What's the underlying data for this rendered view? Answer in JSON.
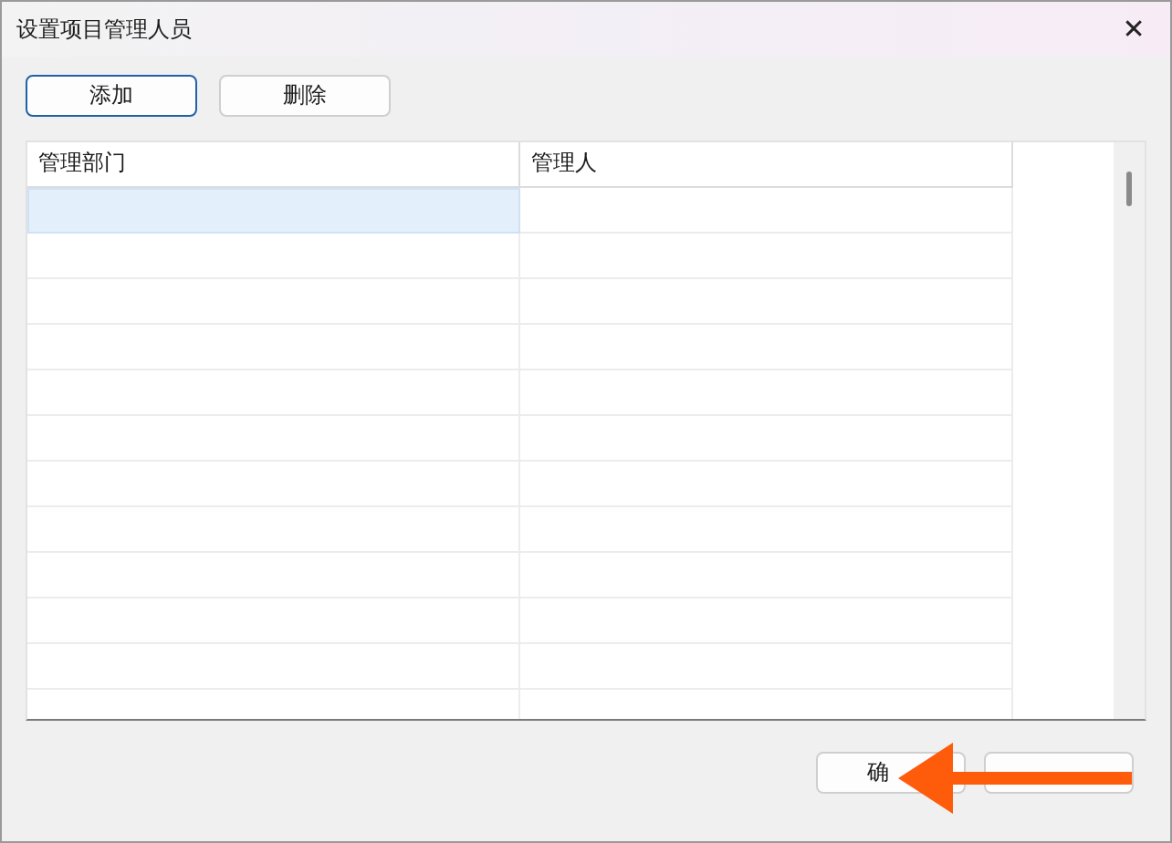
{
  "window": {
    "title": "设置项目管理人员",
    "close": "✕"
  },
  "toolbar": [
    {
      "label": "添加",
      "focused": true
    },
    {
      "label": "删除",
      "focused": false
    }
  ],
  "table": {
    "columns": [
      "管理部门",
      "管理人"
    ],
    "rows": [
      {
        "selected": true
      },
      {
        "selected": false
      },
      {
        "selected": false
      },
      {
        "selected": false
      },
      {
        "selected": false
      },
      {
        "selected": false
      },
      {
        "selected": false
      },
      {
        "selected": false
      },
      {
        "selected": false
      },
      {
        "selected": false
      },
      {
        "selected": false
      },
      {
        "selected": false
      }
    ]
  },
  "buttons": [
    {
      "kind": "button",
      "label": "确"
    },
    {
      "kind": "button"
    }
  ],
  "annotation": {
    "kind": "arrow"
  }
}
